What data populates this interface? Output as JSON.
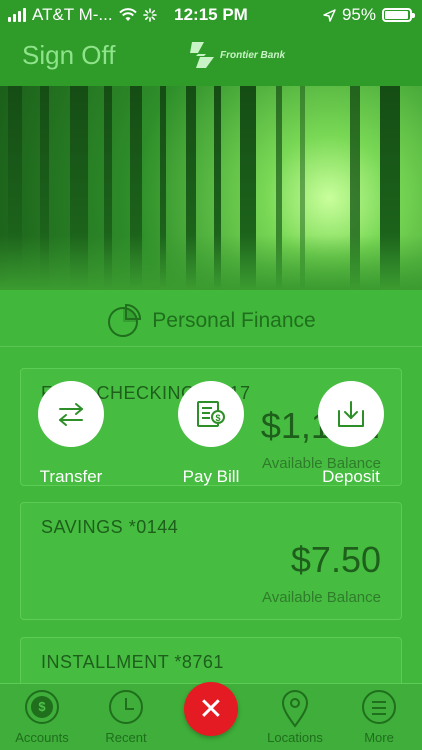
{
  "status_bar": {
    "carrier": "AT&T M-...",
    "time": "12:15 PM",
    "battery": "95%",
    "battery_level": 0.95
  },
  "header": {
    "sign_off": "Sign Off",
    "bank_name": "Frontier Bank"
  },
  "section": {
    "title": "Personal Finance"
  },
  "accounts": [
    {
      "name": "FREE CHECKING *5817",
      "amount": "$1,108.",
      "caption": "Available Balance"
    },
    {
      "name": "SAVINGS *0144",
      "amount": "$7.50",
      "caption": "Available Balance"
    },
    {
      "name": "INSTALLMENT *8761",
      "amount": "",
      "caption": ""
    }
  ],
  "quick_actions": [
    {
      "label": "Transfer",
      "icon": "transfer-arrows-icon"
    },
    {
      "label": "Pay Bill",
      "icon": "bill-icon"
    },
    {
      "label": "Deposit",
      "icon": "deposit-download-icon"
    }
  ],
  "tabs": [
    {
      "label": "Accounts",
      "icon": "dollar-coin-icon"
    },
    {
      "label": "Recent",
      "icon": "clock-icon"
    },
    {
      "label": "Locations",
      "icon": "map-pin-icon"
    },
    {
      "label": "More",
      "icon": "menu-lines-icon"
    }
  ],
  "colors": {
    "primary_green": "#41b83c",
    "dark_green": "#1d5f1b",
    "close_red": "#e51b23"
  }
}
